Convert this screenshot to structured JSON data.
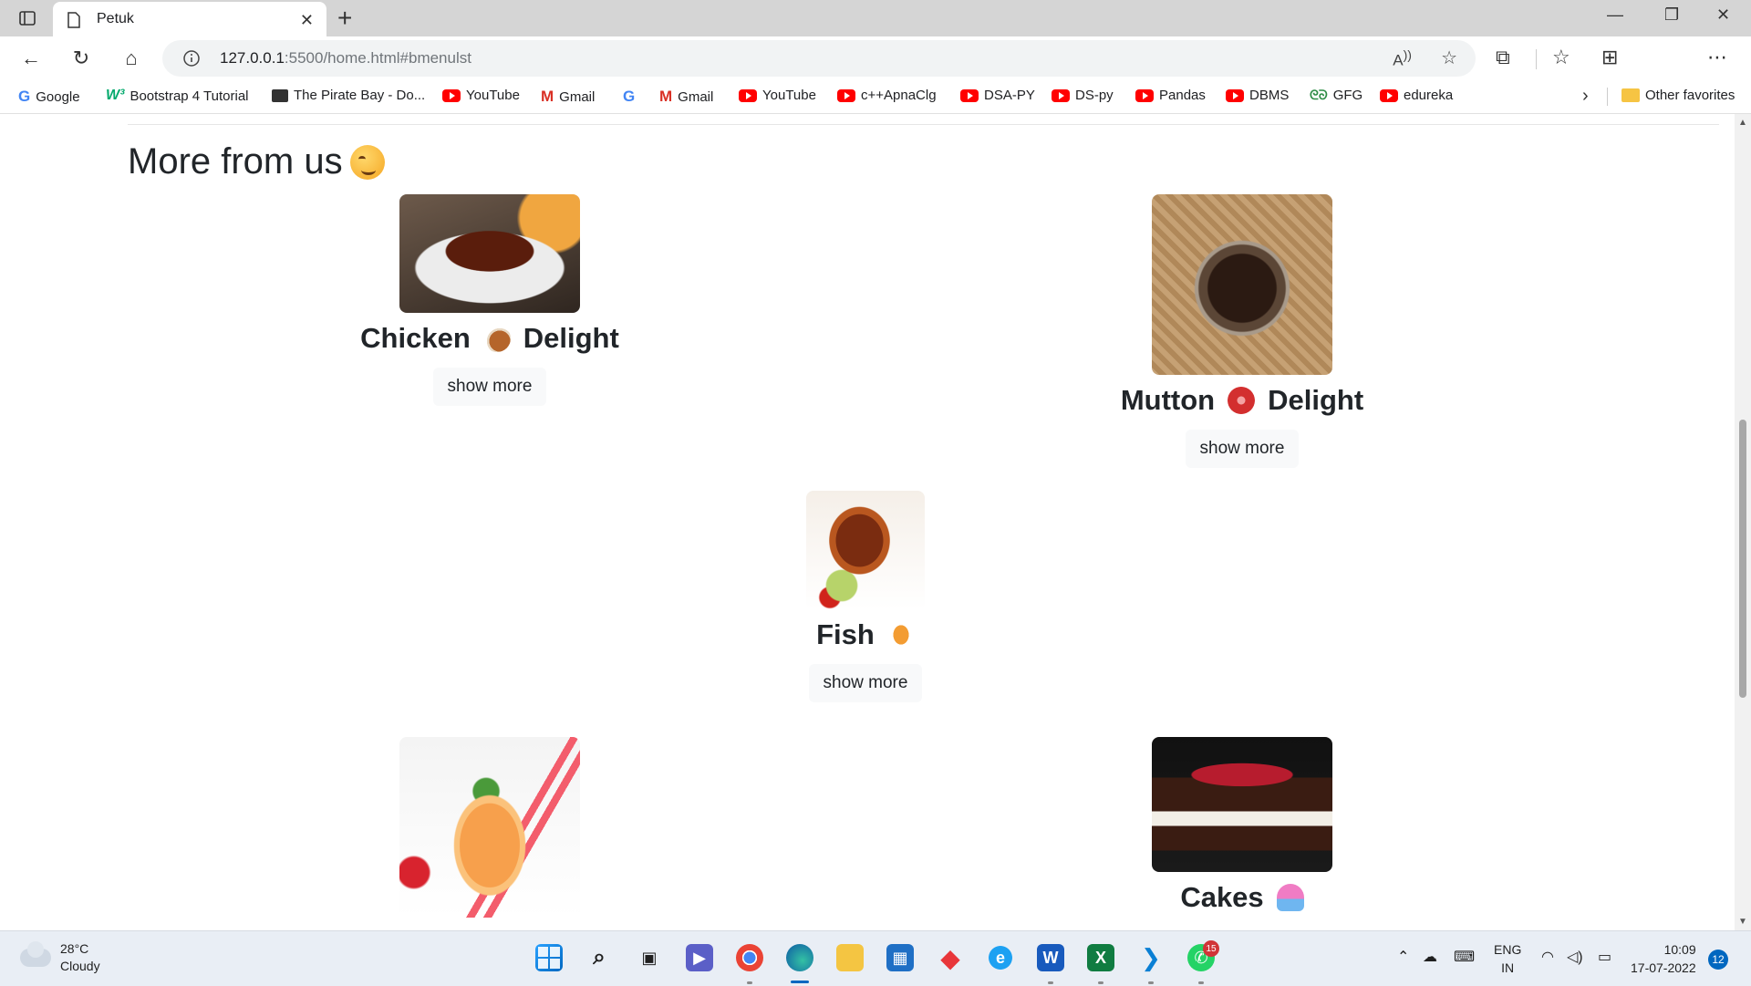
{
  "browser": {
    "tab_title": "Petuk",
    "url_host": "127.0.0.1",
    "url_rest": ":5500/home.html#bmenulst",
    "bookmarks": [
      {
        "label": "Google",
        "icon": "google-icon"
      },
      {
        "label": "Bootstrap 4 Tutorial",
        "icon": "w3schools-icon"
      },
      {
        "label": "The Pirate Bay - Do...",
        "icon": "piratebay-icon"
      },
      {
        "label": "YouTube",
        "icon": "youtube-icon"
      },
      {
        "label": "Gmail",
        "icon": "gmail-icon"
      },
      {
        "label": "",
        "icon": "google-icon"
      },
      {
        "label": "Gmail",
        "icon": "gmail-icon"
      },
      {
        "label": "YouTube",
        "icon": "youtube-icon"
      },
      {
        "label": "c++ApnaClg",
        "icon": "youtube-icon"
      },
      {
        "label": "DSA-PY",
        "icon": "youtube-icon"
      },
      {
        "label": "DS-py",
        "icon": "youtube-icon"
      },
      {
        "label": "Pandas",
        "icon": "youtube-icon"
      },
      {
        "label": "DBMS",
        "icon": "youtube-icon"
      },
      {
        "label": "GFG",
        "icon": "gfg-icon"
      },
      {
        "label": "edureka",
        "icon": "youtube-icon"
      }
    ],
    "other_favorites": "Other favorites"
  },
  "page": {
    "heading": "More from us",
    "show_more": "show more",
    "cards": [
      {
        "name_a": "Chicken",
        "name_b": "Delight",
        "emoji": "chicken-leg-emoji"
      },
      {
        "name_a": "Mutton",
        "name_b": "Delight",
        "emoji": "meat-emoji"
      },
      {
        "name_a": "Fish",
        "name_b": "",
        "emoji": "fish-emoji"
      },
      {
        "name_a": "",
        "name_b": "",
        "emoji": "drink"
      },
      {
        "name_a": "Cakes",
        "name_b": "",
        "emoji": "cupcake-emoji"
      }
    ]
  },
  "taskbar": {
    "weather_temp": "28°C",
    "weather_desc": "Cloudy",
    "whatsapp_badge": "15",
    "lang_1": "ENG",
    "lang_2": "IN",
    "time": "10:09",
    "date": "17-07-2022",
    "notifications": "12"
  },
  "colors": {
    "accent": "#0067c0",
    "youtube": "#ff0000",
    "heading": "#212529"
  }
}
